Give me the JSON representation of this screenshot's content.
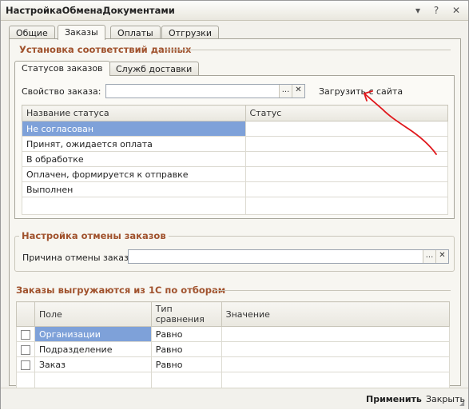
{
  "window": {
    "title": "НастройкаОбменаДокументами",
    "controls": {
      "menu_glyph": "▾",
      "help_glyph": "?",
      "close_glyph": "✕"
    }
  },
  "tabs": [
    {
      "label": "Общие",
      "active": false
    },
    {
      "label": "Заказы",
      "active": true
    },
    {
      "label": "Оплаты",
      "active": false
    },
    {
      "label": "Отгрузки",
      "active": false
    }
  ],
  "mapping": {
    "title": "Установка соответствий данных",
    "tabs": [
      {
        "label": "Статусов заказов",
        "active": true
      },
      {
        "label": "Служб доставки",
        "active": false
      }
    ],
    "property_label": "Свойство заказа:",
    "property_value": "",
    "select_glyph": "...",
    "clear_glyph": "✕",
    "load_link": "Загрузить с сайта",
    "table": {
      "columns": [
        "Название статуса",
        "Статус"
      ],
      "rows": [
        {
          "name": "Не согласован",
          "status": "",
          "selected": true
        },
        {
          "name": "Принят, ожидается оплата",
          "status": ""
        },
        {
          "name": "В обработке",
          "status": ""
        },
        {
          "name": "Оплачен, формируется к отправке",
          "status": ""
        },
        {
          "name": "Выполнен",
          "status": ""
        }
      ]
    }
  },
  "cancel": {
    "title": "Настройка отмены заказов",
    "reason_label": "Причина отмены заказа:",
    "reason_value": "",
    "select_glyph": "...",
    "clear_glyph": "✕"
  },
  "filters": {
    "title": "Заказы выгружаются из 1С по отборам",
    "columns": [
      "",
      "Поле",
      "Тип сравнения",
      "Значение"
    ],
    "rows": [
      {
        "checked": false,
        "field": "Организации",
        "comparison": "Равно",
        "value": "",
        "selected": true
      },
      {
        "checked": false,
        "field": "Подразделение",
        "comparison": "Равно",
        "value": ""
      },
      {
        "checked": false,
        "field": "Заказ",
        "comparison": "Равно",
        "value": ""
      }
    ]
  },
  "footer": {
    "apply": "Применить",
    "close": "Закрыть"
  },
  "colors": {
    "accent_section": "#a0522d",
    "selection": "#7ea1d9",
    "annotation": "#e0161b"
  }
}
